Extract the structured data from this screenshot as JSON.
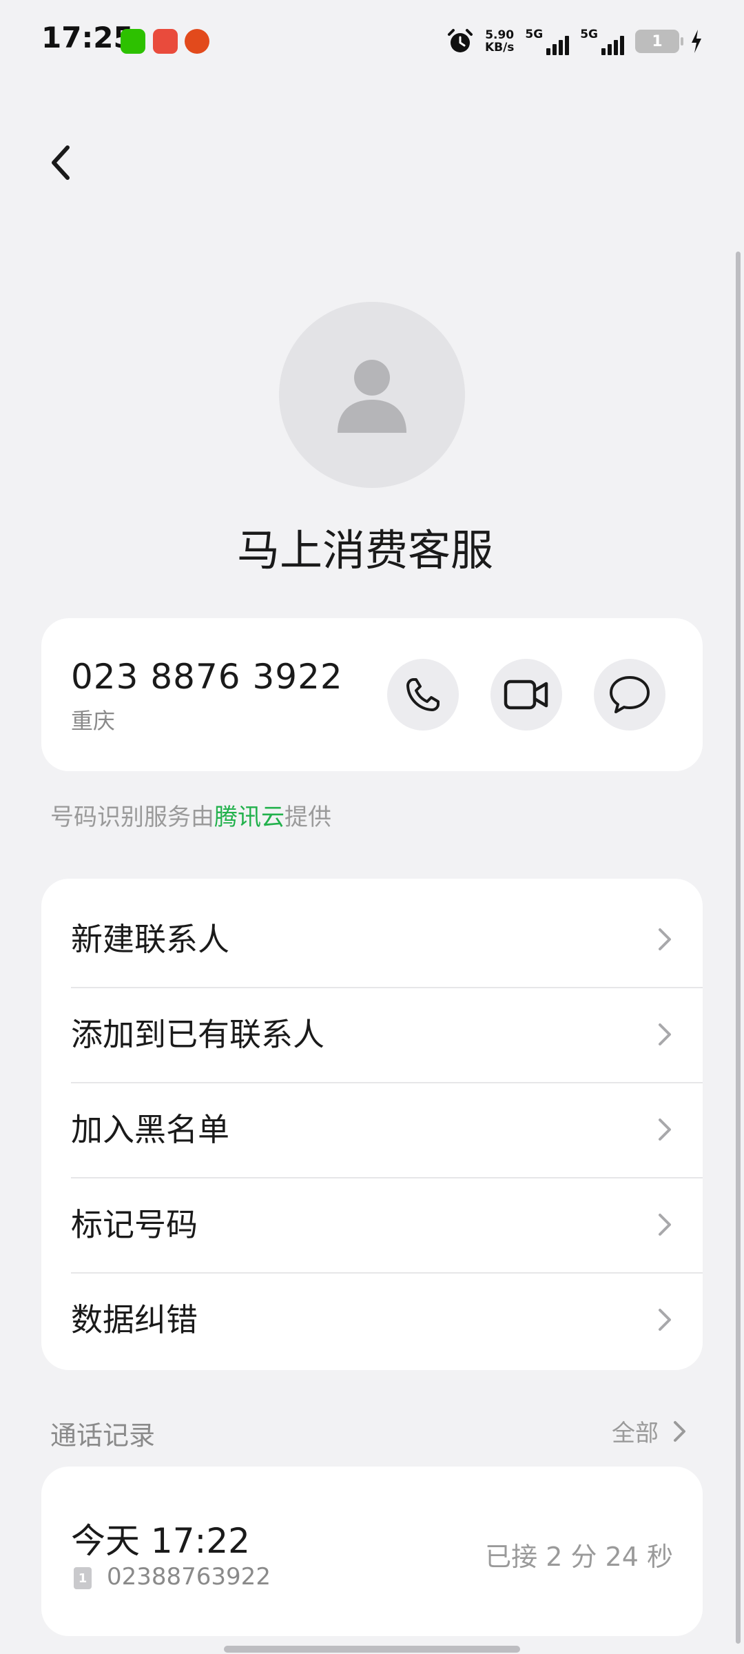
{
  "status_bar": {
    "time": "17:25",
    "net_speed_value": "5.90",
    "net_speed_unit": "KB/s",
    "sim1_network": "5G",
    "sim2_network": "5G",
    "battery_level": "1",
    "app_icons": [
      "wechat-icon",
      "toutiao-icon",
      "red-envelope-icon"
    ]
  },
  "contact": {
    "name": "马上消费客服"
  },
  "phone_card": {
    "number": "023 8876 3922",
    "location": "重庆"
  },
  "provider_note": {
    "prefix": "号码识别服务由",
    "provider": "腾讯云",
    "suffix": "提供"
  },
  "menu": {
    "items": [
      {
        "label": "新建联系人"
      },
      {
        "label": "添加到已有联系人"
      },
      {
        "label": "加入黑名单"
      },
      {
        "label": "标记号码"
      },
      {
        "label": "数据纠错"
      }
    ]
  },
  "call_log": {
    "title": "通话记录",
    "view_all": "全部",
    "entries": [
      {
        "time": "今天 17:22",
        "sim": "1",
        "number": "02388763922",
        "status": "已接 2 分 24 秒"
      }
    ]
  },
  "colors": {
    "background": "#f2f2f4",
    "card": "#ffffff",
    "provider_accent": "#22b14c",
    "secondary_text": "#9a9a9a"
  }
}
